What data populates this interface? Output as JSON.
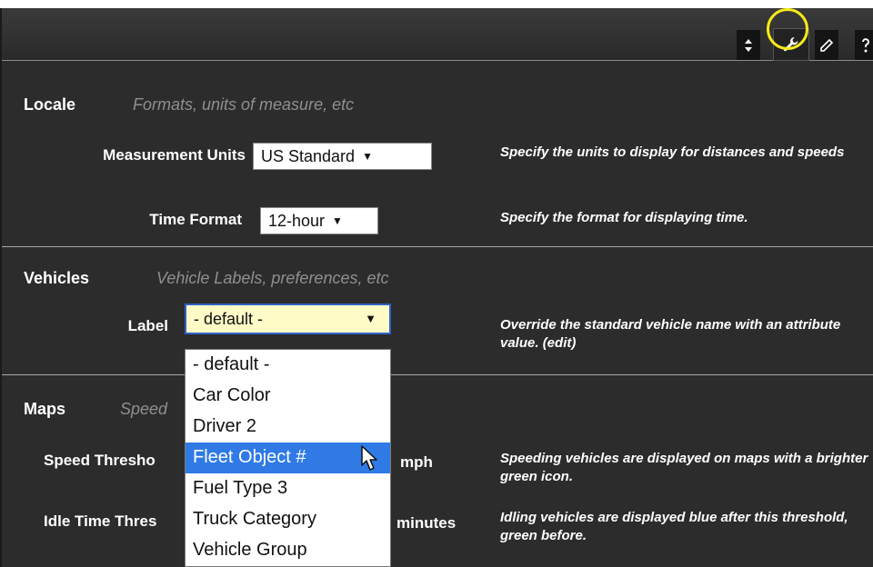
{
  "toolbar": {
    "buttons": [
      {
        "icon": "sort-icon"
      },
      {
        "icon": "wrench-icon",
        "highlighted": true
      },
      {
        "icon": "pencil-icon"
      },
      {
        "icon": "help-icon"
      }
    ],
    "highlight_color": "#f6ea1a"
  },
  "locale": {
    "title": "Locale",
    "subtitle": "Formats, units of measure, etc",
    "measurement": {
      "label": "Measurement Units",
      "value": "US Standard",
      "description": "Specify the units to display for distances and speeds"
    },
    "time": {
      "label": "Time Format",
      "value": "12-hour",
      "description": "Specify the format for displaying time."
    }
  },
  "vehicles": {
    "title": "Vehicles",
    "subtitle": "Vehicle Labels, preferences, etc",
    "label": {
      "label": "Label",
      "value": "- default -",
      "description": "Override the standard vehicle name with an attribute value. (edit)",
      "options": [
        "- default -",
        "Car Color",
        "Driver 2",
        "Fleet Object #",
        "Fuel Type 3",
        "Truck Category",
        "Vehicle Group"
      ],
      "highlighted_option": "Fleet Object #"
    }
  },
  "maps": {
    "title": "Maps",
    "subtitle_visible": "Speed",
    "speed": {
      "label_visible": "Speed Thresho",
      "unit": "mph",
      "description": "Speeding vehicles are displayed on maps with a brighter green icon."
    },
    "idle": {
      "label_visible": "Idle Time Thres",
      "unit": "minutes",
      "description": "Idling vehicles are displayed blue after this threshold, green before."
    }
  },
  "colors": {
    "panel_bg": "#2c2c2c",
    "subtitle_gray": "#8f8f8f",
    "select_highlight_bg": "#fffbc7",
    "dropdown_selected": "#2f7ae5",
    "focus_border": "#2f62c8"
  }
}
